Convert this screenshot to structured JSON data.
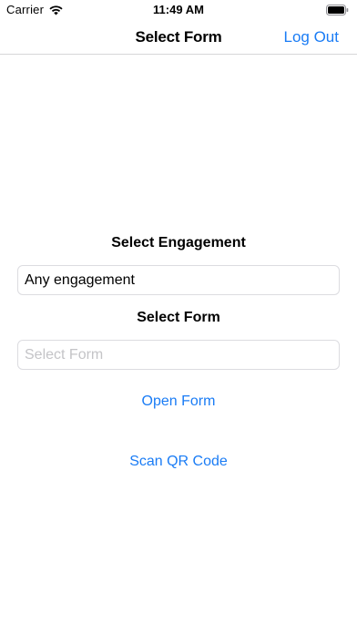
{
  "status_bar": {
    "carrier": "Carrier",
    "time": "11:49 AM",
    "wifi_icon": "wifi-icon",
    "battery_icon": "battery-icon"
  },
  "nav": {
    "title": "Select Form",
    "logout_label": "Log Out"
  },
  "engagement": {
    "label": "Select Engagement",
    "value": "Any engagement"
  },
  "form": {
    "label": "Select Form",
    "placeholder": "Select Form"
  },
  "actions": {
    "open_form_label": "Open Form",
    "scan_qr_label": "Scan QR Code"
  },
  "colors": {
    "accent": "#1a7cf5",
    "field_border": "#dcdce0",
    "placeholder": "#c4c4c7",
    "separator": "#d6d6d8"
  }
}
